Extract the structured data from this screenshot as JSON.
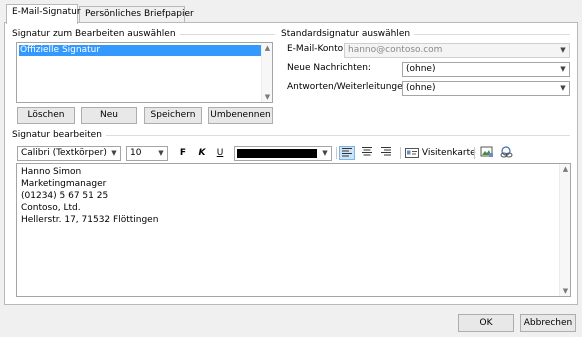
{
  "tabs": [
    {
      "label": "E-Mail-Signatur",
      "active": true
    },
    {
      "label": "Persönliches Briefpapier",
      "active": false
    }
  ],
  "select_signature": {
    "group_label": "Signatur zum Bearbeiten auswählen",
    "items": [
      "Offizielle Signatur"
    ],
    "selected_index": 0,
    "buttons": {
      "delete": "Löschen",
      "new": "Neu",
      "save": "Speichern",
      "rename": "Umbenennen"
    }
  },
  "default_signature": {
    "group_label": "Standardsignatur auswählen",
    "account_label": "E-Mail-Konto:",
    "account_value": "hanno@contoso.com",
    "new_messages_label": "Neue Nachrichten:",
    "new_messages_value": "(ohne)",
    "replies_label": "Antworten/Weiterleitungen:",
    "replies_value": "(ohne)"
  },
  "edit_signature": {
    "group_label": "Signatur bearbeiten",
    "toolbar": {
      "font_family": "Calibri (Textkörper)",
      "font_size": "10",
      "bold_label": "F",
      "italic_label": "K",
      "underline_label": "U",
      "font_color": "#000000",
      "business_card_label": "Visitenkarte"
    },
    "lines": [
      "Hanno Simon",
      "Marketingmanager",
      "(01234) 5 67 51 25",
      "Contoso, Ltd.",
      "Hellerstr. 17, 71532 Flöttingen"
    ]
  },
  "footer": {
    "ok": "OK",
    "cancel": "Abbrechen"
  }
}
